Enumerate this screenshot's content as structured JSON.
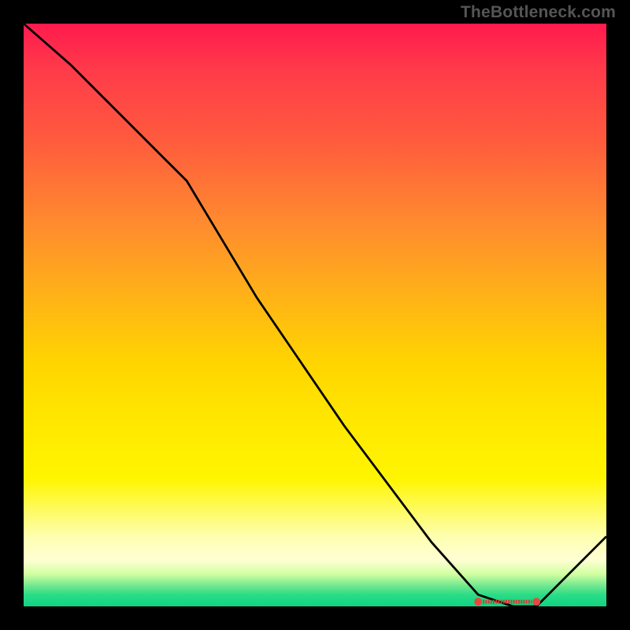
{
  "watermark": "TheBottleneck.com",
  "chart_data": {
    "type": "line",
    "title": "",
    "xlabel": "",
    "ylabel": "",
    "x_range": [
      0,
      100
    ],
    "y_range": [
      0,
      100
    ],
    "series": [
      {
        "name": "curve",
        "x": [
          0,
          8,
          16,
          24,
          28,
          40,
          55,
          70,
          78,
          84,
          88,
          100
        ],
        "y": [
          100,
          93,
          85,
          77,
          73,
          53,
          31,
          11,
          2,
          0,
          0,
          12
        ]
      }
    ],
    "markers": [
      {
        "x": 78,
        "y": 0.8,
        "label": ""
      },
      {
        "x": 88,
        "y": 0.8,
        "label": ""
      }
    ],
    "marker_label": {
      "x": 83,
      "y": 0.8,
      "text": ""
    }
  },
  "colors": {
    "curve": "#000000",
    "marker": "#e24a3f",
    "marker_text": "#d43a31"
  }
}
